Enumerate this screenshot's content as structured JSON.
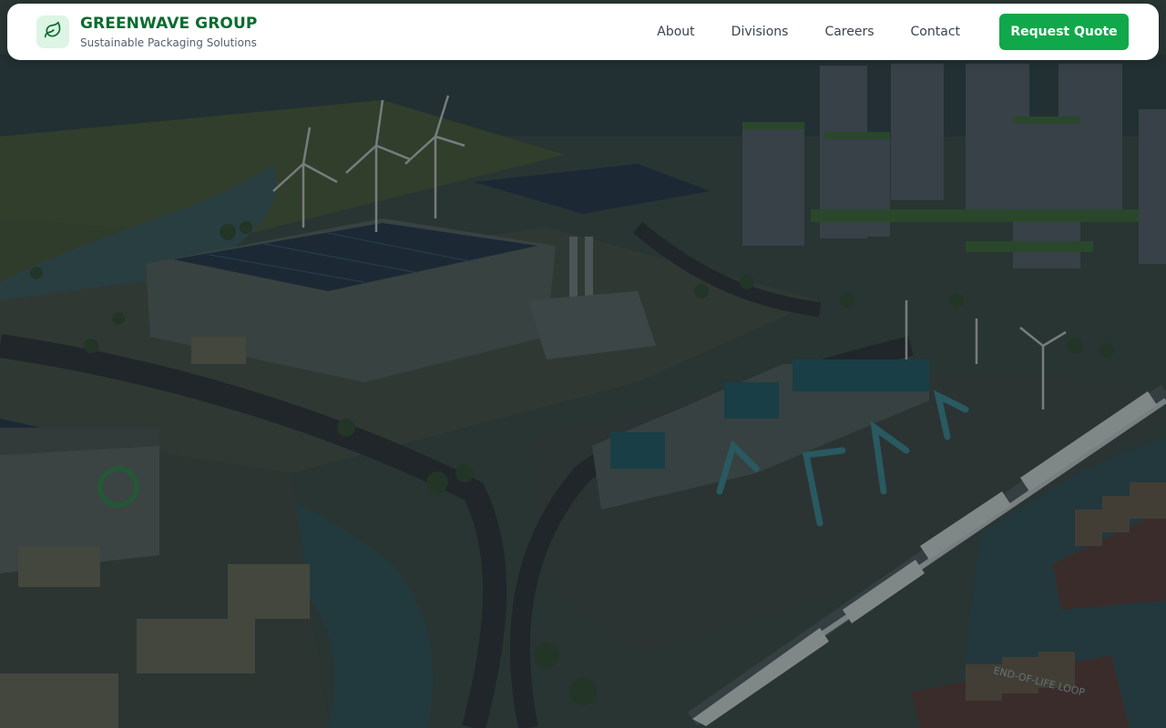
{
  "brand": {
    "name": "GREENWAVE GROUP",
    "tagline": "Sustainable Packaging Solutions",
    "logo_icon": "leaf-icon"
  },
  "nav": {
    "links": [
      "About",
      "Divisions",
      "Careers",
      "Contact"
    ],
    "cta_label": "Request Quote"
  },
  "hero": {
    "image_subject": "eco-industrial-park-illustration",
    "sign_text": "END-OF-LIFE LOOP"
  },
  "colors": {
    "brand_green": "#0b6b2f",
    "cta_green": "#10a84a",
    "logo_bg": "#dcf5e4"
  }
}
